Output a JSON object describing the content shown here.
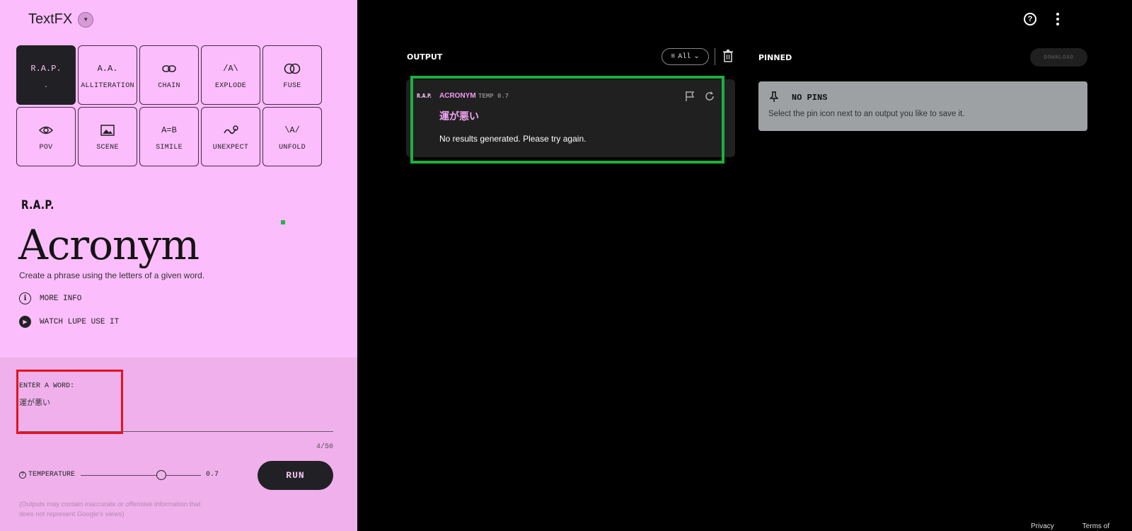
{
  "app": {
    "title": "TextFX"
  },
  "tools": [
    {
      "icon": "R.A.P.",
      "label": ".",
      "active": true
    },
    {
      "icon": "A.A.",
      "label": "ALLITERATION"
    },
    {
      "icon": "⊶",
      "label": "CHAIN"
    },
    {
      "icon": "/A\\",
      "label": "EXPLODE"
    },
    {
      "icon": "◐◑",
      "label": "FUSE"
    },
    {
      "icon": "◎",
      "label": "POV"
    },
    {
      "icon": "▣",
      "label": "SCENE"
    },
    {
      "icon": "A=B",
      "label": "SIMILE"
    },
    {
      "icon": "∿",
      "label": "UNEXPECT"
    },
    {
      "icon": "\\A/",
      "label": "UNFOLD"
    }
  ],
  "selected_tool": {
    "logo": "R.A.P.",
    "title": "Acronym",
    "description": "Create a phrase using the letters of a given word.",
    "more_info": "MORE INFO",
    "watch": "WATCH LUPE USE IT"
  },
  "input": {
    "label": "ENTER A WORD:",
    "value": "運が悪い",
    "counter": "4/50"
  },
  "temperature": {
    "label": "TEMPERATURE",
    "value": "0.7",
    "fraction": 0.67
  },
  "run_label": "RUN",
  "disclaimer": "(Outputs may contain inaccurate or offensive information that does not represent Google's views)",
  "top_icons": [
    "help-icon",
    "more-vert-icon"
  ],
  "output": {
    "label": "OUTPUT",
    "filter": "All",
    "card": {
      "logo": "R.A.P.",
      "type": "ACRONYM",
      "temp": "TEMP 0.7",
      "word": "運が悪い",
      "message": "No results generated. Please try again."
    }
  },
  "pinned": {
    "label": "PINNED",
    "download": "DOWNLOAD",
    "empty_title": "NO PINS",
    "empty_text": "Select the pin icon next to an output you like to save it."
  },
  "footer": {
    "privacy": "Privacy",
    "terms": "Terms of Service"
  },
  "colors": {
    "left_bg": "#fbbdfb",
    "accent_dark": "#212125",
    "highlight_red": "#e2131e",
    "highlight_green": "#1fae3f"
  }
}
